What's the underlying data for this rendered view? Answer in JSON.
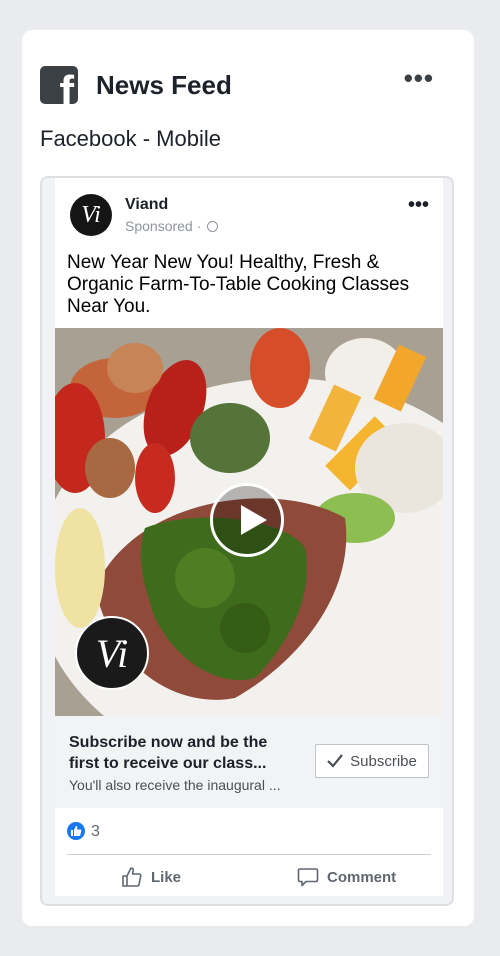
{
  "header": {
    "title": "News Feed",
    "more": "•••",
    "logo_icon": "facebook-icon"
  },
  "subtitle": "Facebook - Mobile",
  "post": {
    "avatar_text": "Vi",
    "author": "Viand",
    "sponsored": "Sponsored ·",
    "more": "•••",
    "text": "New Year New You! Healthy, Fresh & Organic Farm-To-Table Cooking Classes Near You.",
    "media_logo_text": "Vi",
    "cta": {
      "headline": "Subscribe now and be the first to receive our class...",
      "description": "You'll also receive the inaugural ...",
      "button_label": "Subscribe"
    },
    "reaction_count": "3",
    "actions": {
      "like": "Like",
      "comment": "Comment"
    }
  },
  "colors": {
    "background": "#e9ebee",
    "facebook_blue": "#1877f2",
    "logo_dark": "#3b4045"
  }
}
